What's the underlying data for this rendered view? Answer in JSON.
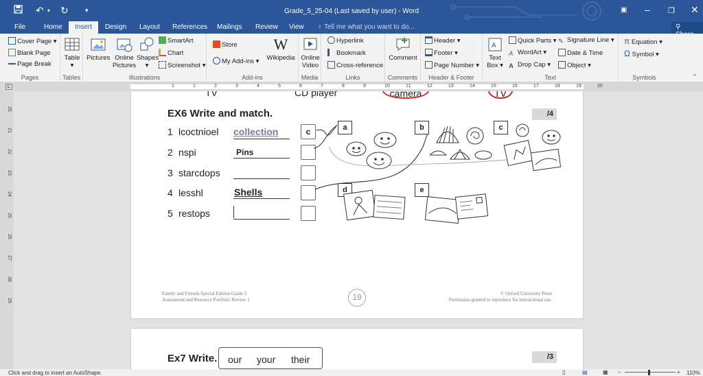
{
  "window": {
    "title": "Grade_5_25-04 (Last saved by user) - Word",
    "share_label": "Share",
    "tell_me_placeholder": "Tell me what you want to do..."
  },
  "tabs": [
    {
      "label": "File"
    },
    {
      "label": "Home"
    },
    {
      "label": "Insert"
    },
    {
      "label": "Design"
    },
    {
      "label": "Layout"
    },
    {
      "label": "References"
    },
    {
      "label": "Mailings"
    },
    {
      "label": "Review"
    },
    {
      "label": "View"
    }
  ],
  "ribbon": {
    "pages": {
      "label": "Pages",
      "items": [
        "Cover Page",
        "Blank Page",
        "Page Break"
      ]
    },
    "tables": {
      "label": "Tables",
      "items": [
        "Table"
      ]
    },
    "illustrations": {
      "label": "Illustrations",
      "items": [
        "Pictures",
        "Online Pictures",
        "Shapes",
        "SmartArt",
        "Chart",
        "Screenshot"
      ]
    },
    "addins": {
      "label": "Add-ins",
      "items": [
        "Store",
        "My Add-ins",
        "Wikipedia"
      ]
    },
    "media": {
      "label": "Media",
      "items": [
        "Online Video"
      ]
    },
    "links": {
      "label": "Links",
      "items": [
        "Hyperlink",
        "Bookmark",
        "Cross-reference"
      ]
    },
    "comments": {
      "label": "Comments",
      "items": [
        "Comment"
      ]
    },
    "header_footer": {
      "label": "Header & Footer",
      "items": [
        "Header",
        "Footer",
        "Page Number"
      ]
    },
    "text": {
      "label": "Text",
      "items": [
        "Text Box",
        "Quick Parts",
        "WordArt",
        "Drop Cap",
        "Signature Line",
        "Date & Time",
        "Object"
      ]
    },
    "symbols": {
      "label": "Symbols",
      "items": [
        "Equation",
        "Symbol"
      ]
    }
  },
  "ruler": {
    "numbers": [
      "1",
      "1",
      "2",
      "3",
      "4",
      "5",
      "6",
      "7",
      "8",
      "9",
      "10",
      "11",
      "12",
      "13",
      "14",
      "15",
      "16",
      "17",
      "18",
      "19",
      "20"
    ]
  },
  "vruler": {
    "numbers": [
      "20",
      "21",
      "22",
      "23",
      "24",
      "25",
      "26",
      "27",
      "28",
      "29"
    ]
  },
  "doc": {
    "top_partial": [
      "TV",
      "CD player",
      "camera",
      "TV"
    ],
    "ex6": {
      "title": "EX6 Write and match.",
      "score": "/4",
      "rows": [
        {
          "num": "1",
          "word": "lcoctnioel",
          "answer": "collection"
        },
        {
          "num": "2",
          "word": "nspi",
          "answer": "Pins"
        },
        {
          "num": "3",
          "word": "starcdops",
          "answer": ""
        },
        {
          "num": "4",
          "word": "lesshl",
          "answer": "Shells"
        },
        {
          "num": "5",
          "word": "restops",
          "answer": ""
        }
      ],
      "box_letter": "c",
      "pictures": [
        "a",
        "b",
        "c",
        "d",
        "e"
      ]
    },
    "footer": {
      "left1": "Family and Friends Special Edition Grade 5",
      "left2": "Assessment and Resource Portfolio Review 1",
      "page_num": "19",
      "right1": "© Oxford University Press",
      "right2": "Permission granted to reproduce for instructional use."
    },
    "ex7": {
      "title": "Ex7 Write.",
      "words": [
        "our",
        "your",
        "their"
      ],
      "score": "/3"
    }
  },
  "status": {
    "text": "Click and drag to insert an AutoShape.",
    "zoom": "110%"
  },
  "colors": {
    "brand": "#2b579a",
    "red_circle": "#d42020"
  }
}
